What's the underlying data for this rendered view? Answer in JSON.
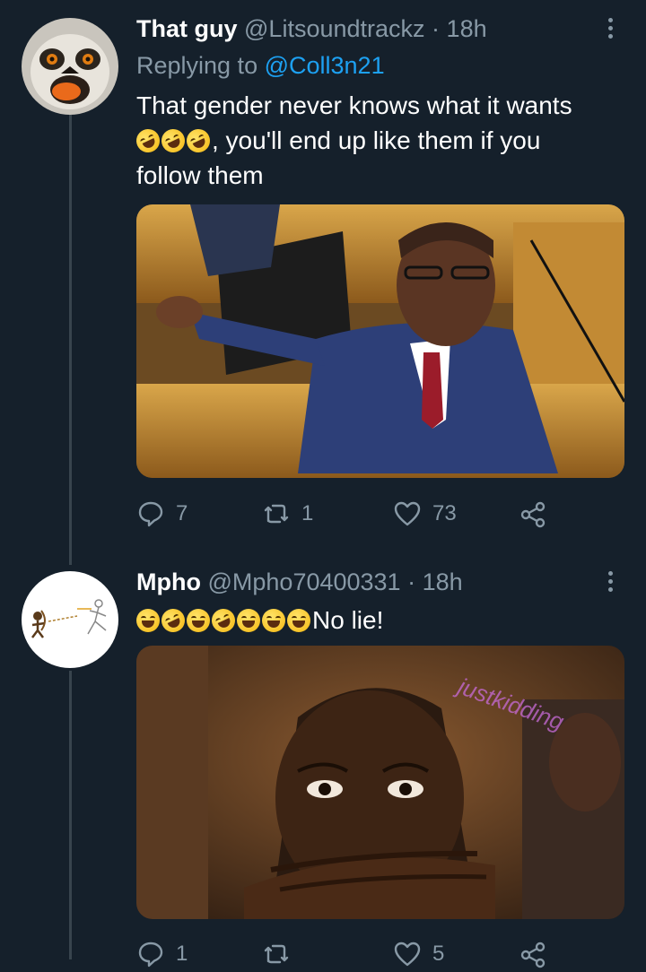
{
  "tweets": [
    {
      "author_name": "That guy",
      "handle": "@Litsoundtrackz",
      "separator": "·",
      "time": "18h",
      "replying_prefix": "Replying to",
      "replying_to": "@Coll3n21",
      "text_line1": "That gender never knows what it wants",
      "text_line2": ", you'll end up like them if you",
      "text_line3": "follow them",
      "avatar_icon": "lemur-avatar",
      "media_icon": "politician-pointing-photo",
      "reply_count": "7",
      "retweet_count": "1",
      "like_count": "73"
    },
    {
      "author_name": "Mpho",
      "handle": "@Mpho70400331",
      "separator": "·",
      "time": "18h",
      "text_after_emoji": "No lie!",
      "avatar_icon": "archer-sketch-avatar",
      "media_icon": "girl-surprised-photo",
      "media_watermark": "justkidding",
      "reply_count": "1",
      "retweet_count": "",
      "like_count": "5"
    }
  ],
  "colors": {
    "background": "#15202b",
    "muted": "#8899a6",
    "link": "#1da1f2",
    "thread_line": "#38444d"
  }
}
